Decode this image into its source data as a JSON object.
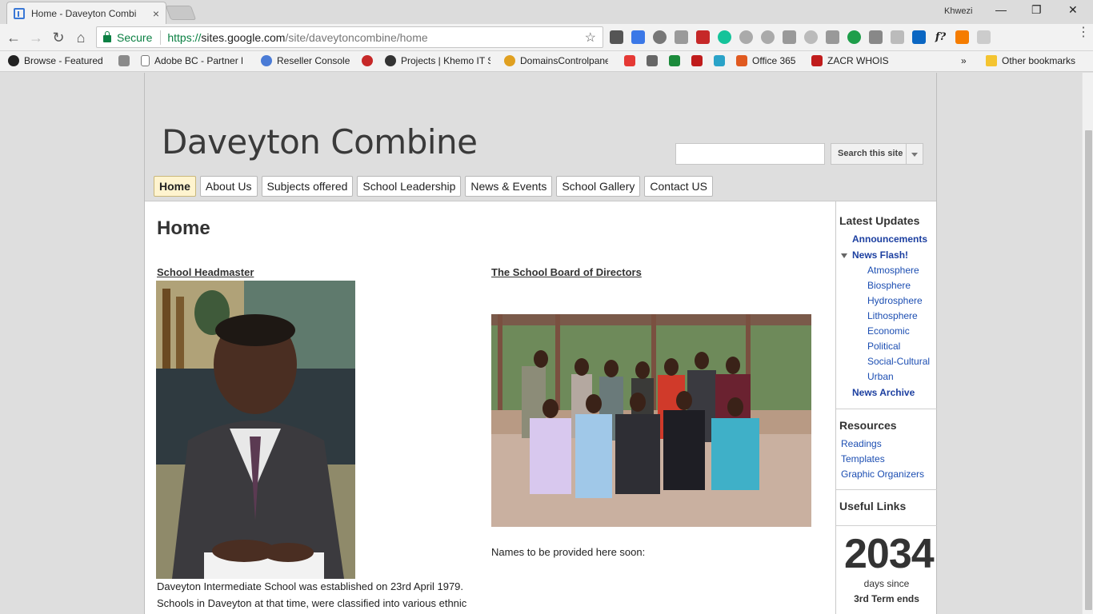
{
  "browser": {
    "tab_title": "Home - Daveyton Combi",
    "tab_close": "×",
    "profile": "Khwezi",
    "minimize": "—",
    "restore": "❐",
    "close": "✕",
    "back": "←",
    "forward": "→",
    "reload": "↻",
    "home": "⌂",
    "secure_label": "Secure",
    "url_proto": "https://",
    "url_host": "sites.google.com",
    "url_path": "/site/daveytoncombine/home",
    "star": "☆",
    "menu": "⋮",
    "ext_f": "f?",
    "bookmarks": [
      {
        "label": "Browse - Featured",
        "color": "#1db954"
      },
      {
        "label": "Adobe BC - Partner F",
        "color": "#8a8a8a"
      },
      {
        "label": "Reseller Console",
        "color": "#4a7bd6"
      },
      {
        "label": "Projects | Khemo IT S",
        "color": "#333333"
      },
      {
        "label": "DomainsControlpane",
        "color": "#e0a020"
      },
      {
        "label": "Office 365",
        "color": "#e05a20"
      },
      {
        "label": "ZACR WHOIS",
        "color": "#c01c1c"
      }
    ],
    "bookmarks_more": "»",
    "other_bookmarks": "Other bookmarks"
  },
  "site": {
    "title": "Daveyton Combine",
    "search_button": "Search this site",
    "nav": [
      "Home",
      "About Us",
      "Subjects offered",
      "School Leadership",
      "News & Events",
      "School Gallery",
      "Contact US"
    ]
  },
  "main": {
    "page_title": "Home",
    "col1_heading": "School Headmaster",
    "col2_heading": "The School Board of Directors",
    "names_note": "Names to be provided here soon:",
    "intro_line1": "Daveyton Intermediate School was established on 23rd April 1979.",
    "intro_line2": "Schools in Daveyton at that time, were classified into various ethnic"
  },
  "sidebar": {
    "latest_updates": "Latest Updates",
    "announcements": "Announcements",
    "news_flash": "News Flash!",
    "news_items": [
      "Atmosphere",
      "Biosphere",
      "Hydrosphere",
      "Lithosphere",
      "Economic",
      "Political",
      "Social-Cultural",
      "Urban"
    ],
    "news_archive": "News Archive",
    "resources": "Resources",
    "resource_items": [
      "Readings",
      "Templates",
      "Graphic Organizers"
    ],
    "useful_links": "Useful Links",
    "counter_value": "2034",
    "counter_label": "days since",
    "counter_event": "3rd Term ends"
  }
}
